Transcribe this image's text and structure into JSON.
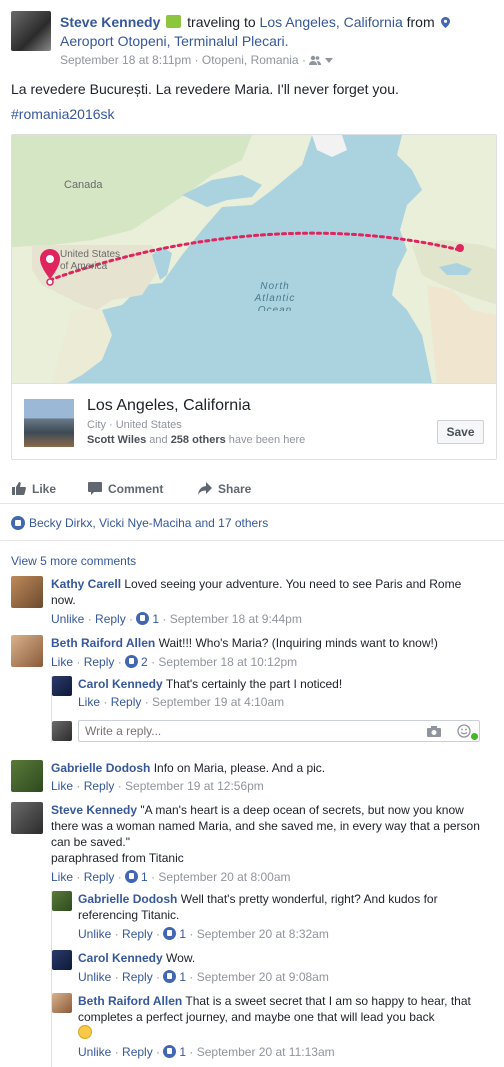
{
  "header": {
    "name": "Steve Kennedy",
    "activity": "traveling to",
    "destination": "Los Angeles, California",
    "from_word": "from",
    "origin": "Aeroport Otopeni, Terminalul Plecari.",
    "timestamp": "September 18 at 8:11pm",
    "location": "Otopeni, Romania"
  },
  "post": {
    "text": "La revedere București. La revedere Maria. I'll never forget you.",
    "hashtag": "#romania2016sk"
  },
  "map": {
    "labels": {
      "canada": "Canada",
      "usa": "United States of America",
      "ocean": "North Atlantic Ocean"
    },
    "route_color": "#e0245e"
  },
  "place_card": {
    "title": "Los Angeles, California",
    "subtitle": "City · United States",
    "friends_a": "Scott Wiles",
    "friends_mid": "and",
    "friends_b": "258 others",
    "friends_tail": "have been here",
    "save_label": "Save"
  },
  "actions": {
    "like": "Like",
    "comment": "Comment",
    "share": "Share"
  },
  "reactions": {
    "text": "Becky Dirkx, Vicki Nye-Maciha and 17 others"
  },
  "comments_link": "View 5 more comments",
  "reply_placeholder": "Write a reply...",
  "comments": [
    {
      "name": "Kathy Carell",
      "text": "Loved seeing your adventure. You need to see Paris and Rome now.",
      "unlike": "Unlike",
      "reply": "Reply",
      "count": "1",
      "time": "September 18 at 9:44pm"
    },
    {
      "name": "Beth Raiford Allen",
      "text": "Wait!!! Who's Maria? (Inquiring minds want to know!)",
      "like": "Like",
      "reply": "Reply",
      "count": "2",
      "time": "September 18 at 10:12pm"
    },
    {
      "name": "Carol Kennedy",
      "text": "That's certainly the part I noticed!",
      "like": "Like",
      "reply": "Reply",
      "time": "September 19 at 4:10am"
    },
    {
      "name": "Gabrielle Dodosh",
      "text": "Info on Maria, please. And a pic.",
      "like": "Like",
      "reply": "Reply",
      "time": "September 19 at 12:56pm"
    },
    {
      "name": "Steve Kennedy",
      "text": "\"A man's heart is a deep ocean of secrets, but now you know there was a woman named Maria, and she saved me, in every way that a person can be saved.\"",
      "text2": "paraphrased from Titanic",
      "like": "Like",
      "reply": "Reply",
      "count": "1",
      "time": "September 20 at 8:00am"
    },
    {
      "name": "Gabrielle Dodosh",
      "text": "Well that's pretty wonderful, right? And kudos for referencing Titanic.",
      "unlike": "Unlike",
      "reply": "Reply",
      "count": "1",
      "time": "September 20 at 8:32am"
    },
    {
      "name": "Carol Kennedy",
      "text": "Wow.",
      "unlike": "Unlike",
      "reply": "Reply",
      "count": "1",
      "time": "September 20 at 9:08am"
    },
    {
      "name": "Beth Raiford Allen",
      "text": "That is a sweet secret that I am so happy to hear, that completes a perfect journey, and maybe one that will lead you back",
      "unlike": "Unlike",
      "reply": "Reply",
      "count": "1",
      "time": "September 20 at 11:13am"
    }
  ]
}
